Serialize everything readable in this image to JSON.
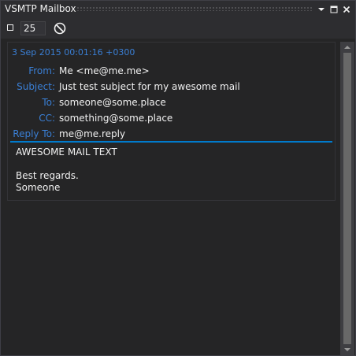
{
  "window": {
    "title": "VSMTP Mailbox"
  },
  "toolbar": {
    "count_value": "25"
  },
  "mail": {
    "date": "3 Sep 2015 00:01:16 +0300",
    "headers": [
      {
        "label": "From:",
        "value": "Me <me@me.me>"
      },
      {
        "label": "Subject:",
        "value": "Just test subject for my awesome mail"
      },
      {
        "label": "To:",
        "value": "someone@some.place"
      },
      {
        "label": "CC:",
        "value": "something@some.place"
      },
      {
        "label": "Reply To:",
        "value": "me@me.reply"
      }
    ],
    "body": {
      "line1": "AWESOME MAIL TEXT",
      "line2": "Best regards.",
      "line3": "Someone"
    }
  },
  "colors": {
    "accent": "#007acc",
    "header_label": "#3a7fd5",
    "background": "#252526"
  },
  "icons": {
    "stop": "stop-icon",
    "clear": "clear-icon",
    "dropdown": "dropdown-arrow-icon",
    "maximize": "maximize-icon",
    "close": "close-icon"
  }
}
